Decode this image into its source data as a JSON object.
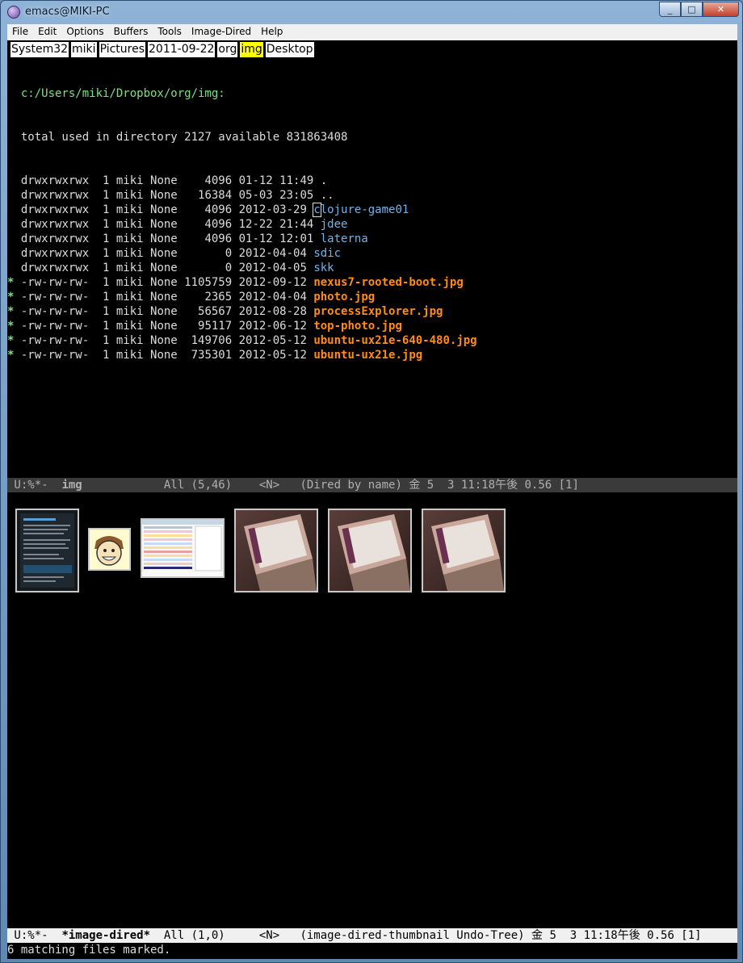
{
  "window": {
    "title": "emacs@MIKI-PC",
    "controls": {
      "minimize": "_",
      "maximize": "□",
      "close": "✕"
    }
  },
  "menubar": [
    "File",
    "Edit",
    "Options",
    "Buffers",
    "Tools",
    "Image-Dired",
    "Help"
  ],
  "tabbar": {
    "items": [
      "System32",
      "miki",
      "Pictures",
      "2011-09-22",
      "org",
      "img",
      "Desktop"
    ],
    "active": "img"
  },
  "dired": {
    "path_line": "  c:/Users/miki/Dropbox/org/img:",
    "total_line": "  total used in directory 2127 available 831863408",
    "entries": [
      {
        "mark": " ",
        "info": " drwxrwxrwx  1 miki None    4096 01-12 11:49 ",
        "name": ".",
        "kind": "plain"
      },
      {
        "mark": " ",
        "info": " drwxrwxrwx  1 miki None   16384 05-03 23:05 ",
        "name": "..",
        "kind": "plain"
      },
      {
        "mark": " ",
        "info": " drwxrwxrwx  1 miki None    4096 2012-03-29 ",
        "name": "clojure-game01",
        "kind": "dir"
      },
      {
        "mark": " ",
        "info": " drwxrwxrwx  1 miki None    4096 12-22 21:44 ",
        "name": "jdee",
        "kind": "dir"
      },
      {
        "mark": " ",
        "info": " drwxrwxrwx  1 miki None    4096 01-12 12:01 ",
        "name": "laterna",
        "kind": "dir"
      },
      {
        "mark": " ",
        "info": " drwxrwxrwx  1 miki None       0 2012-04-04 ",
        "name": "sdic",
        "kind": "dir"
      },
      {
        "mark": " ",
        "info": " drwxrwxrwx  1 miki None       0 2012-04-05 ",
        "name": "skk",
        "kind": "dir"
      },
      {
        "mark": "*",
        "info": " -rw-rw-rw-  1 miki None 1105759 2012-09-12 ",
        "name": "nexus7-rooted-boot.jpg",
        "kind": "img"
      },
      {
        "mark": "*",
        "info": " -rw-rw-rw-  1 miki None    2365 2012-04-04 ",
        "name": "photo.jpg",
        "kind": "img"
      },
      {
        "mark": "*",
        "info": " -rw-rw-rw-  1 miki None   56567 2012-08-28 ",
        "name": "processExplorer.jpg",
        "kind": "img"
      },
      {
        "mark": "*",
        "info": " -rw-rw-rw-  1 miki None   95117 2012-06-12 ",
        "name": "top-photo.jpg",
        "kind": "img"
      },
      {
        "mark": "*",
        "info": " -rw-rw-rw-  1 miki None  149706 2012-05-12 ",
        "name": "ubuntu-ux21e-640-480.jpg",
        "kind": "img"
      },
      {
        "mark": "*",
        "info": " -rw-rw-rw-  1 miki None  735301 2012-05-12 ",
        "name": "ubuntu-ux21e.jpg",
        "kind": "img"
      }
    ]
  },
  "modeline_top": {
    "status": " U:%*-  ",
    "buffer": "img",
    "rest": "            All (5,46)    <N>   (Dired by name) 金 5  3 11:18午後 0.56 [1]"
  },
  "thumbnails": [
    {
      "title": "nexus7-rooted-boot.jpg"
    },
    {
      "title": "photo.jpg"
    },
    {
      "title": "processExplorer.jpg"
    },
    {
      "title": "top-photo.jpg"
    },
    {
      "title": "ubuntu-ux21e-640-480.jpg"
    },
    {
      "title": "ubuntu-ux21e.jpg"
    }
  ],
  "modeline_bottom": {
    "status": " U:%*-  ",
    "buffer": "*image-dired*",
    "rest": "  All (1,0)     <N>   (image-dired-thumbnail Undo-Tree) 金 5  3 11:18午後 0.56 [1]"
  },
  "echo_area": "6 matching files marked.",
  "colors": {
    "background": "#000000",
    "directory": "#6fb4ef",
    "marked_image": "#ff8c1a",
    "mark_star": "#7fe07f",
    "active_tab": "#ffff00"
  }
}
